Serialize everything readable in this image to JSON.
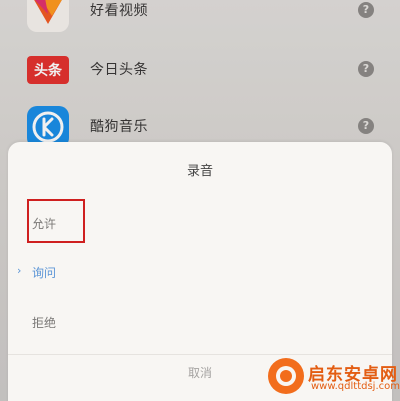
{
  "apps": [
    {
      "name": "好看视频",
      "icon": "haokan-app-icon",
      "help": "?"
    },
    {
      "name": "今日头条",
      "icon": "toutiao-app-icon",
      "icon_text": "头条",
      "help": "?"
    },
    {
      "name": "酷狗音乐",
      "icon": "kugou-app-icon",
      "help": "?"
    }
  ],
  "dialog": {
    "title": "录音",
    "options": [
      "允许",
      "询问",
      "拒绝"
    ],
    "selected": "询问",
    "cancel": "取消"
  },
  "watermark": {
    "title": "启东安卓网",
    "url": "www.qdlttdsj.com"
  },
  "colors": {
    "selected_option": "#5b95d6",
    "highlight_box": "#cf1f1f",
    "toutiao_red": "#e4322f",
    "kugou_blue": "#1b8fe8",
    "watermark_orange": "#e35d12"
  }
}
